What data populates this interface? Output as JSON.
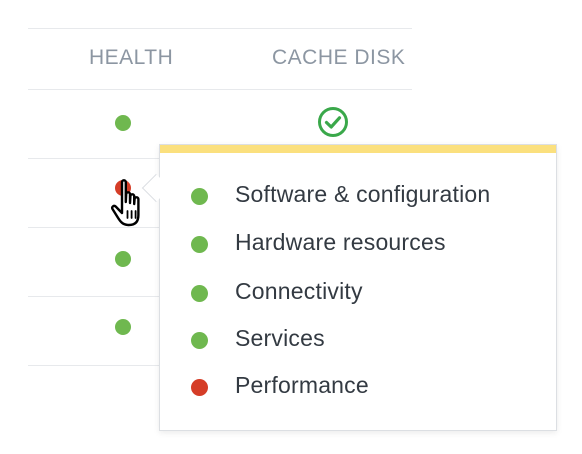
{
  "table": {
    "headers": {
      "health": "HEALTH",
      "cache_disk": "CACHE DISK"
    },
    "rows": [
      {
        "health": "green",
        "cache_disk_icon": "check-circle-icon"
      },
      {
        "health": "red"
      },
      {
        "health": "green"
      },
      {
        "health": "green"
      }
    ]
  },
  "popover": {
    "items": [
      {
        "label": "Software & configuration",
        "status": "green"
      },
      {
        "label": "Hardware resources",
        "status": "green"
      },
      {
        "label": "Connectivity",
        "status": "green"
      },
      {
        "label": "Services",
        "status": "green"
      },
      {
        "label": "Performance",
        "status": "red"
      }
    ]
  },
  "colors": {
    "green": "#6fb84f",
    "red": "#d53d27",
    "check": "#3aa84a",
    "accent": "#fbe07e",
    "header_text": "#8c96a2",
    "label_text": "#333a42"
  },
  "icons": {
    "status_dot": "status-dot-icon",
    "check": "check-circle-icon",
    "cursor": "hand-pointer-icon"
  }
}
